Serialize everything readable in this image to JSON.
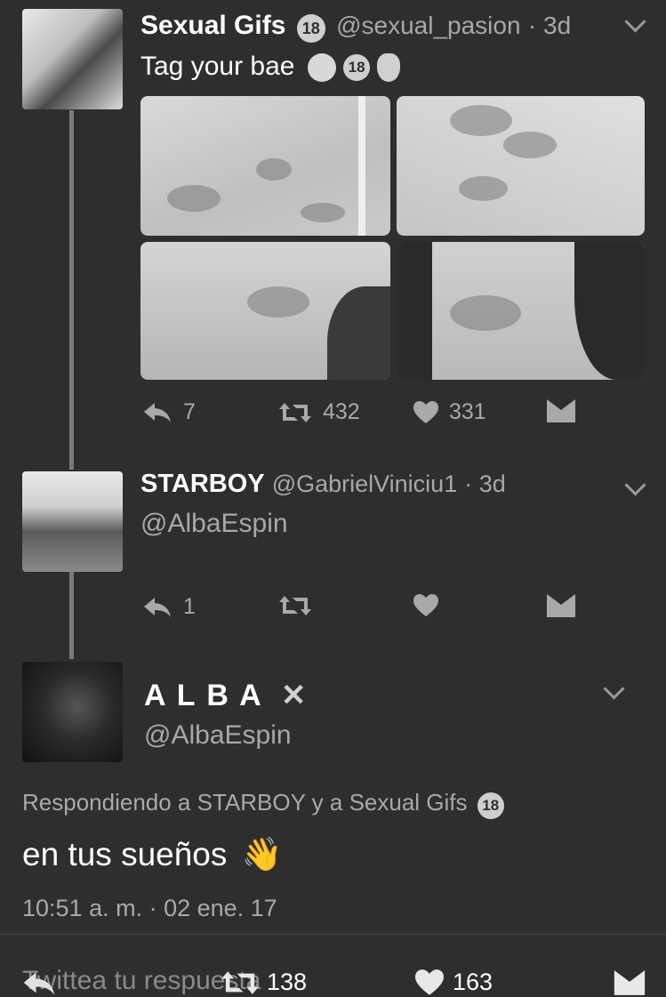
{
  "tweet1": {
    "name": "Sexual Gifs",
    "badge": "18",
    "handle": "@sexual_pasion",
    "time": "· 3d",
    "text": "Tag your bae",
    "emoji_badge": "18",
    "replies": "7",
    "retweets": "432",
    "likes": "331"
  },
  "tweet2": {
    "name": "STARBOY",
    "handle": "@GabrielViniciu1",
    "time": "· 3d",
    "text": "@AlbaEspin",
    "replies": "1"
  },
  "main": {
    "name": "A L B A",
    "name_mark": "✕",
    "handle": "@AlbaEspin",
    "replying_to": "Respondiendo a STARBOY y a Sexual Gifs",
    "replying_badge": "18",
    "text": "en tus sueños",
    "emoji": "👋",
    "timestamp": "10:51 a. m. · 02 ene. 17"
  },
  "bottom_bar": {
    "reply_placeholder": "Twittea tu respuesta",
    "retweets": "138",
    "likes": "163"
  },
  "colors": {
    "background": "#2e2e2f",
    "text": "#e8e8e8",
    "muted": "#a9a9a9",
    "thread_line": "#7a7a7a"
  },
  "icons": [
    "reply-icon",
    "retweet-icon",
    "heart-icon",
    "dm-icon",
    "chevron-down-icon"
  ]
}
